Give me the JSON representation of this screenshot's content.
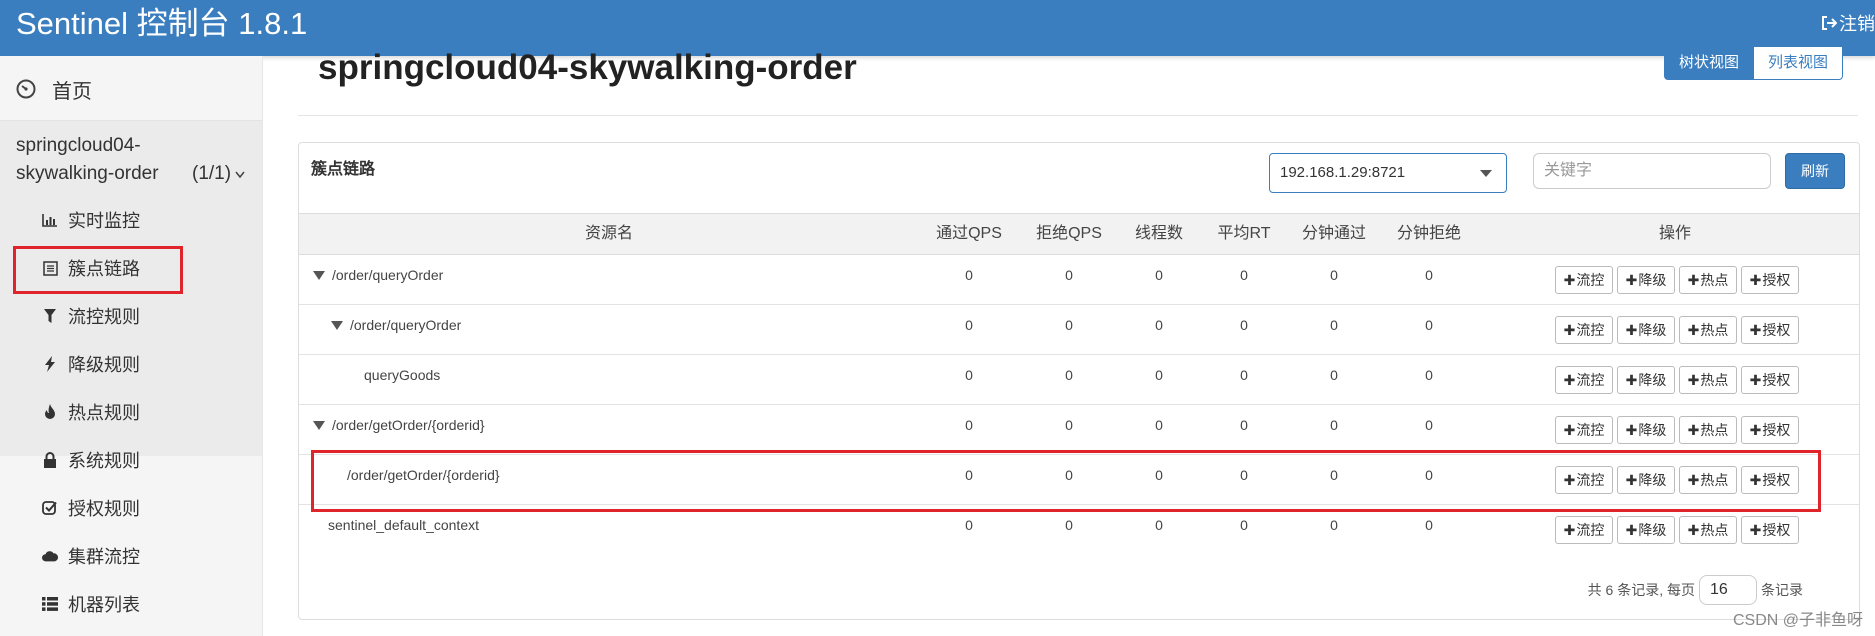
{
  "header": {
    "brand": "Sentinel 控制台 1.8.1",
    "logout_label": "注销"
  },
  "sidebar": {
    "home_label": "首页",
    "app_name_line1": "springcloud04-",
    "app_name_line2": "skywalking-order",
    "app_count": "(1/1)",
    "items": [
      {
        "label": "实时监控",
        "icon": "bar-chart-icon"
      },
      {
        "label": "簇点链路",
        "icon": "list-alt-icon"
      },
      {
        "label": "流控规则",
        "icon": "filter-icon"
      },
      {
        "label": "降级规则",
        "icon": "flash-icon"
      },
      {
        "label": "热点规则",
        "icon": "fire-icon"
      },
      {
        "label": "系统规则",
        "icon": "lock-icon"
      },
      {
        "label": "授权规则",
        "icon": "check-icon"
      },
      {
        "label": "集群流控",
        "icon": "cloud-icon"
      },
      {
        "label": "机器列表",
        "icon": "th-list-icon"
      }
    ]
  },
  "main": {
    "title": "springcloud04-skywalking-order",
    "view_tree": "树状视图",
    "view_list": "列表视图",
    "panel_title": "簇点链路",
    "machine_select": "192.168.1.29:8721",
    "keyword_placeholder": "关键字",
    "refresh_label": "刷新",
    "columns": [
      "资源名",
      "通过QPS",
      "拒绝QPS",
      "线程数",
      "平均RT",
      "分钟通过",
      "分钟拒绝",
      "操作"
    ],
    "rows": [
      {
        "resource": "/order/queryOrder",
        "pass_qps": "0",
        "block_qps": "0",
        "threads": "0",
        "avg_rt": "0",
        "min_pass": "0",
        "min_block": "0"
      },
      {
        "resource": "/order/queryOrder",
        "pass_qps": "0",
        "block_qps": "0",
        "threads": "0",
        "avg_rt": "0",
        "min_pass": "0",
        "min_block": "0"
      },
      {
        "resource": "queryGoods",
        "pass_qps": "0",
        "block_qps": "0",
        "threads": "0",
        "avg_rt": "0",
        "min_pass": "0",
        "min_block": "0"
      },
      {
        "resource": "/order/getOrder/{orderid}",
        "pass_qps": "0",
        "block_qps": "0",
        "threads": "0",
        "avg_rt": "0",
        "min_pass": "0",
        "min_block": "0"
      },
      {
        "resource": "/order/getOrder/{orderid}",
        "pass_qps": "0",
        "block_qps": "0",
        "threads": "0",
        "avg_rt": "0",
        "min_pass": "0",
        "min_block": "0"
      },
      {
        "resource": "sentinel_default_context",
        "pass_qps": "0",
        "block_qps": "0",
        "threads": "0",
        "avg_rt": "0",
        "min_pass": "0",
        "min_block": "0"
      }
    ],
    "ops": [
      "流控",
      "降级",
      "热点",
      "授权"
    ],
    "footer_total": "共 6 条记录, 每页",
    "page_size": "16",
    "footer_suffix": "条记录"
  },
  "watermark": "CSDN @子非鱼呀",
  "colors": {
    "accent": "#3a7ebf",
    "highlight": "#e0242b"
  }
}
